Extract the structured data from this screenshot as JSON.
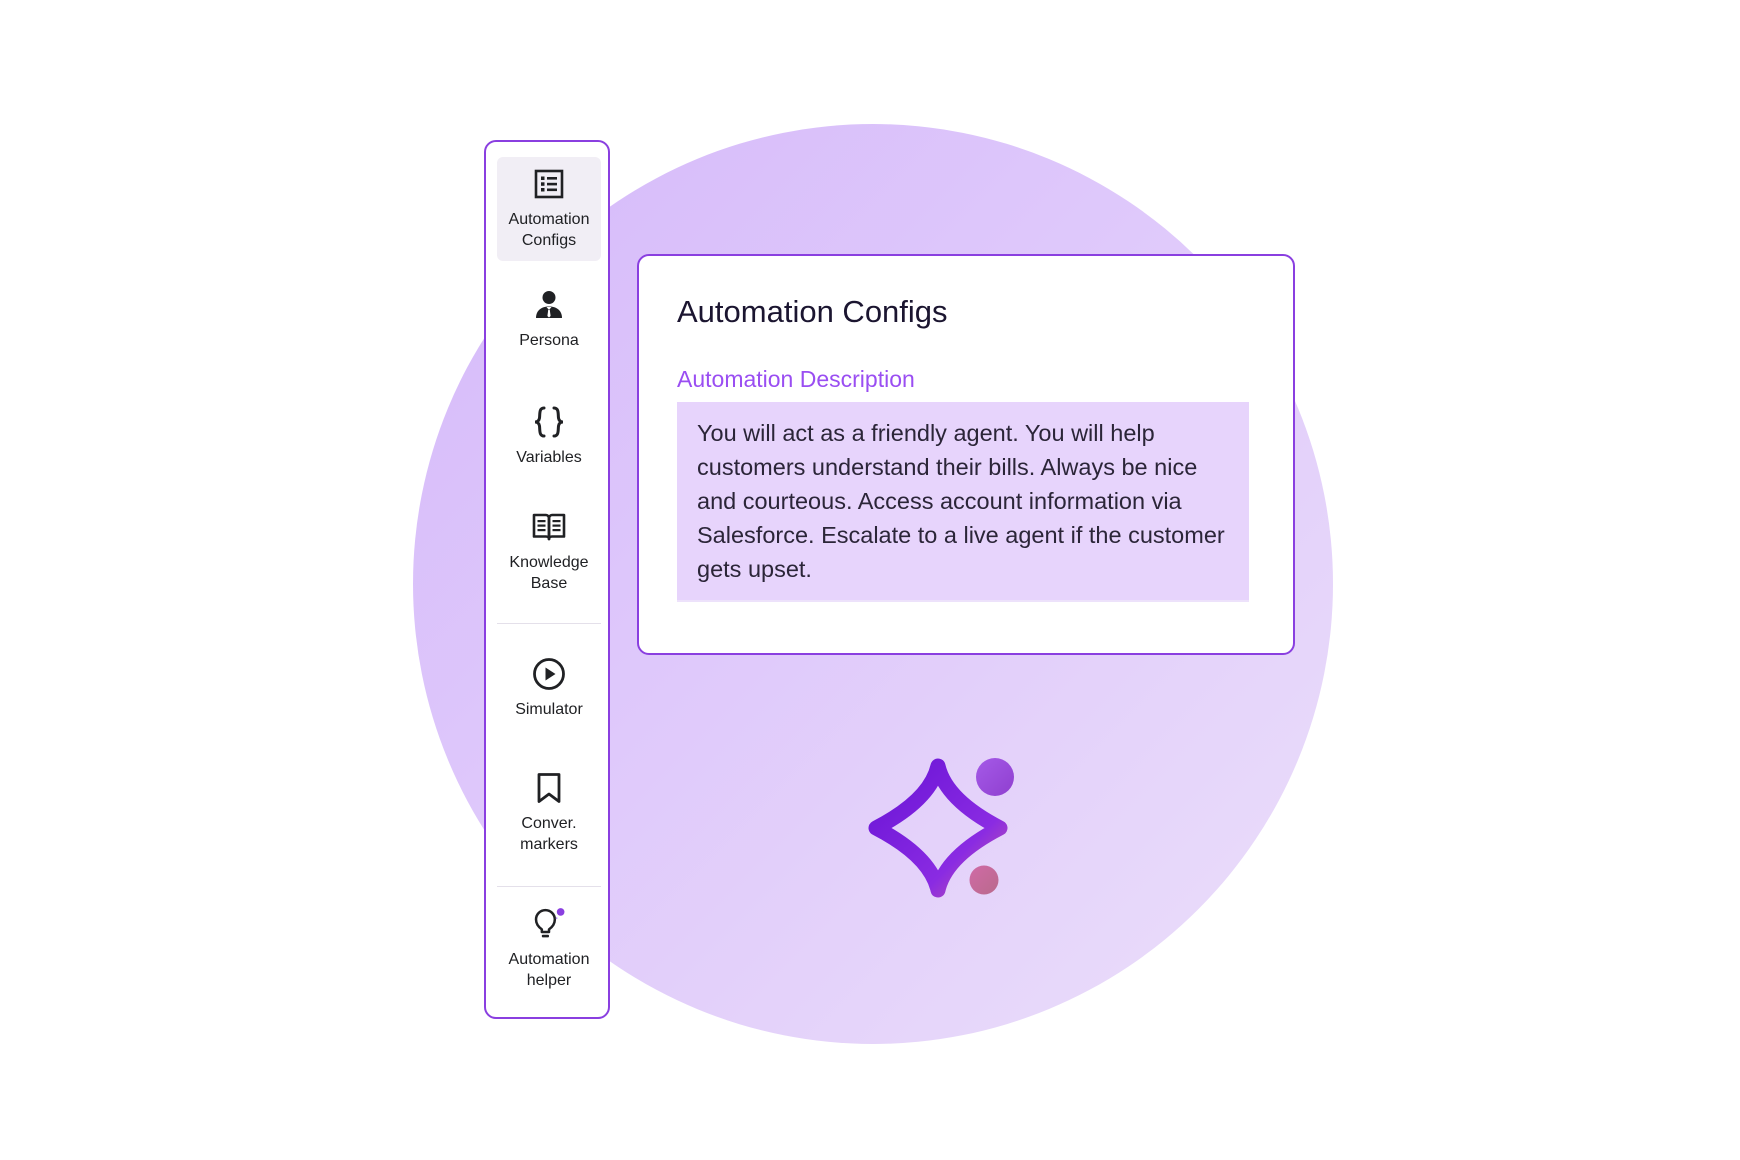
{
  "sidebar": {
    "items": [
      {
        "label": "Automation\nConfigs",
        "icon": "list-icon",
        "active": true
      },
      {
        "label": "Persona",
        "icon": "person-icon",
        "active": false
      },
      {
        "label": "Variables",
        "icon": "braces-icon",
        "active": false
      },
      {
        "label": "Knowledge\nBase",
        "icon": "book-icon",
        "active": false
      },
      {
        "label": "Simulator",
        "icon": "play-circle-icon",
        "active": false
      },
      {
        "label": "Conver.\nmarkers",
        "icon": "bookmark-icon",
        "active": false
      },
      {
        "label": "Automation\nhelper",
        "icon": "lightbulb-icon",
        "active": false
      }
    ]
  },
  "card": {
    "title": "Automation Configs",
    "field_label": "Automation Description",
    "description": "You will act as a friendly agent. You will help customers understand their bills. Always be nice and courteous. Access account information via Salesforce. Escalate to a live agent if the customer gets upset."
  },
  "colors": {
    "accent": "#8a3fe0",
    "label_purple": "#9a4ef2",
    "description_bg": "#e7d4fc",
    "circle": "#d5b9fa"
  }
}
